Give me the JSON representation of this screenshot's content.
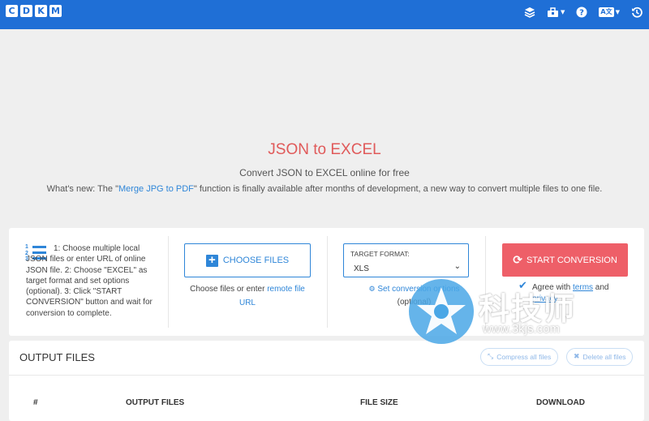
{
  "topbar": {
    "logo_letters": [
      "C",
      "D",
      "K",
      "M"
    ],
    "icons": [
      "layers-icon",
      "toolbox-icon",
      "help-icon",
      "translate-icon",
      "history-icon"
    ],
    "translate_label": "A文",
    "brand_color": "#1f6fd6"
  },
  "hero": {
    "title": "JSON to EXCEL",
    "subtitle": "Convert JSON to EXCEL online for free",
    "whats_new_prefix": "What's new: The \"",
    "whats_new_link": "Merge JPG to PDF",
    "whats_new_suffix": "\" function is finally available after months of development, a new way to convert multiple files to one file.",
    "title_color": "#e05a5a"
  },
  "converter": {
    "steps_text": "1: Choose multiple local JSON files or enter URL of online JSON file. 2: Choose \"EXCEL\" as target format and set options (optional). 3: Click \"START CONVERSION\" button and wait for conversion to complete.",
    "choose_files_label": "CHOOSE FILES",
    "choose_hint_prefix": "Choose files or enter ",
    "choose_hint_link": "remote file URL",
    "target_format_label": "TARGET FORMAT:",
    "target_format_value": "XLS",
    "set_options_label": "Set conversion options",
    "optional_label": "(optional)",
    "start_label": "START CONVERSION",
    "agree_prefix": "Agree with ",
    "agree_terms": "terms",
    "agree_mid": " and ",
    "agree_privacy": "privacy",
    "accent_color": "#2f86d8",
    "start_color": "#ee5f68"
  },
  "output": {
    "title": "OUTPUT FILES",
    "compress_label": "Compress all files",
    "delete_label": "Delete all files",
    "columns": [
      "#",
      "OUTPUT FILES",
      "FILE SIZE",
      "DOWNLOAD"
    ]
  },
  "watermark": {
    "text": "科技师",
    "url": "www.3kjs.com"
  }
}
